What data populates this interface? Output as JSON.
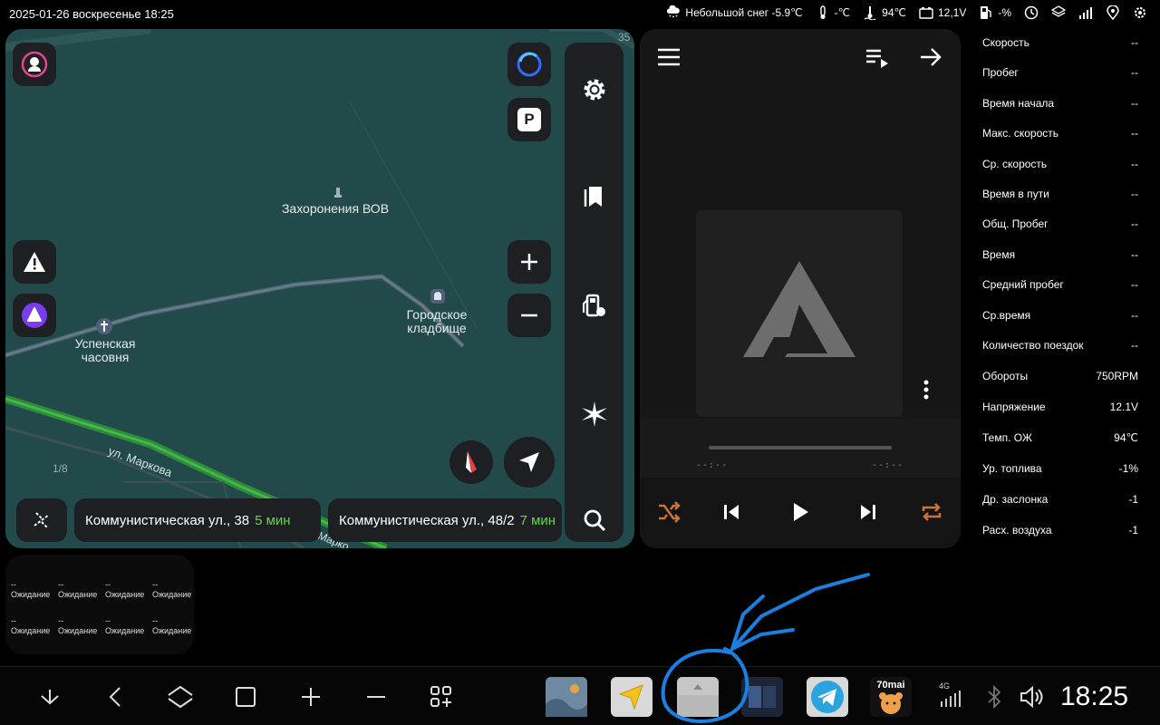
{
  "status_bar": {
    "datetime": "2025-01-26 воскресенье 18:25",
    "weather": "Небольшой снег -5.9℃",
    "outside_temp": "-℃",
    "engine_temp": "94℃",
    "battery_voltage": "12,1V",
    "fuel": "-%"
  },
  "map": {
    "scale_label": "35",
    "poi": {
      "memorial": "Захоронения ВОВ",
      "cemetery_line1": "Городское",
      "cemetery_line2": "кладбище",
      "chapel_line1": "Успенская",
      "chapel_line2": "часовня"
    },
    "street": "ул. Маркова",
    "street2": "Марко",
    "page_indicator": "1/8",
    "parking_label": "P",
    "routes": [
      {
        "address": "Коммунистическая ул., 38",
        "eta": "5 мин"
      },
      {
        "address": "Коммунистическая ул., 48/2",
        "eta": "7 мин"
      }
    ]
  },
  "player": {
    "time_elapsed": "--:--",
    "time_total": "--:--",
    "progress": 0
  },
  "stats": [
    {
      "label": "Скорость",
      "value": "--"
    },
    {
      "label": "Пробег",
      "value": "--"
    },
    {
      "label": "Время начала",
      "value": "--"
    },
    {
      "label": "Макс. скорость",
      "value": "--"
    },
    {
      "label": "Ср. скорость",
      "value": "--"
    },
    {
      "label": "Время в пути",
      "value": "--"
    },
    {
      "label": "Общ. Пробег",
      "value": "--"
    },
    {
      "label": "Время",
      "value": "--"
    },
    {
      "label": "Средний пробег",
      "value": "--"
    },
    {
      "label": "Ср.время",
      "value": "--"
    },
    {
      "label": "Количество поездок",
      "value": "--"
    },
    {
      "label": "Обороты",
      "value": "750RPM"
    },
    {
      "label": "Напряжение",
      "value": "12.1V"
    },
    {
      "label": "Темп. ОЖ",
      "value": "94℃"
    },
    {
      "label": "Ур. топлива",
      "value": "-1%"
    },
    {
      "label": "Др. заслонка",
      "value": "-1"
    },
    {
      "label": "Расх. воздуха",
      "value": "-1"
    }
  ],
  "widget": {
    "value": "--",
    "status": "Ожидание"
  },
  "dock": {
    "clock": "18:25",
    "network": "4G",
    "app_label_70mai": "70mai"
  },
  "colors": {
    "map_bg": "#224a4b",
    "eta_green": "#6bd34d",
    "accent_orange": "#c8733a",
    "annotation_blue": "#1a7fe0"
  }
}
